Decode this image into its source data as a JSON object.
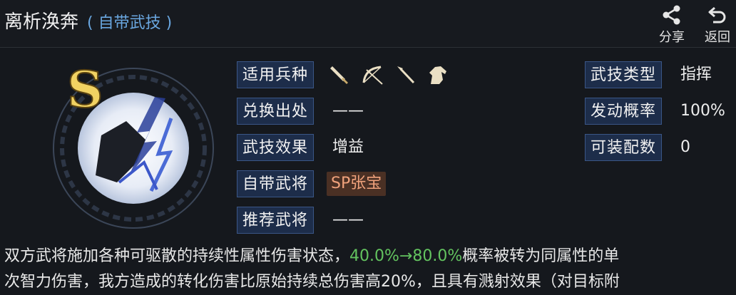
{
  "header": {
    "title": "离析涣奔",
    "subtitle": "( 自带武技 )",
    "share_label": "分享",
    "back_label": "返回"
  },
  "skill": {
    "grade": "S"
  },
  "left_rows": [
    {
      "label": "适用兵种",
      "value": ""
    },
    {
      "label": "兑换出处",
      "value": "——"
    },
    {
      "label": "武技效果",
      "value": "增益"
    },
    {
      "label": "自带武将",
      "value": "SP张宝"
    },
    {
      "label": "推荐武将",
      "value": "——"
    }
  ],
  "unit_icons": [
    "sword-icon",
    "bow-icon",
    "spear-icon",
    "horse-icon"
  ],
  "right_rows": [
    {
      "label": "武技类型",
      "value": "指挥"
    },
    {
      "label": "发动概率",
      "value": "100%"
    },
    {
      "label": "可装配数",
      "value": "0"
    }
  ],
  "description": {
    "line1_prefix": "双方武将施加各种可驱散的持续性属性伤害状态，",
    "line1_highlight": "40.0%→80.0%",
    "line1_suffix": "概率被转为同属性的单",
    "line2": "次智力伤害，我方造成的转化伤害比原始持续总伤害高20%，且具有溅射效果（对目标附"
  },
  "colors": {
    "label_bg": "#1d2d4a",
    "label_border": "#3a5687",
    "accent_blue": "#6aa7e0",
    "highlight_green": "#63c35f",
    "badge_bg": "#4a3024",
    "badge_text": "#f0a27c"
  }
}
